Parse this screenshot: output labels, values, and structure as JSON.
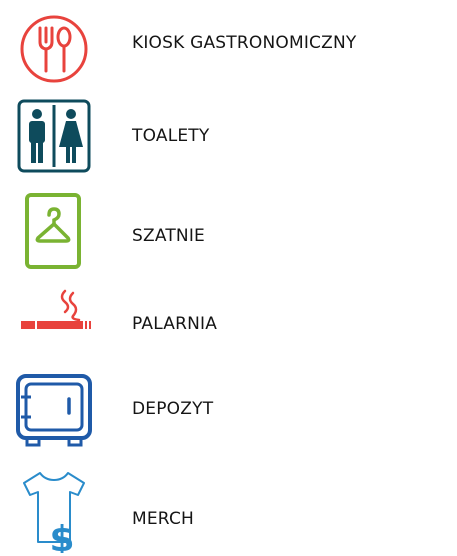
{
  "items": [
    {
      "label": "KIOSK GASTRONOMICZNY",
      "icon": "food-kiosk-icon",
      "color": "#e8433d"
    },
    {
      "label": "TOALETY",
      "icon": "toilets-icon",
      "color": "#0e4b5c"
    },
    {
      "label": "SZATNIE",
      "icon": "cloakroom-hanger-icon",
      "color": "#7ab332"
    },
    {
      "label": "PALARNIA",
      "icon": "smoking-area-icon",
      "color": "#e8433d"
    },
    {
      "label": "DEPOZYT",
      "icon": "deposit-safe-icon",
      "color": "#1f5aa8"
    },
    {
      "label": "MERCH",
      "icon": "merch-tshirt-dollar-icon",
      "color": "#2a8ccb"
    }
  ]
}
